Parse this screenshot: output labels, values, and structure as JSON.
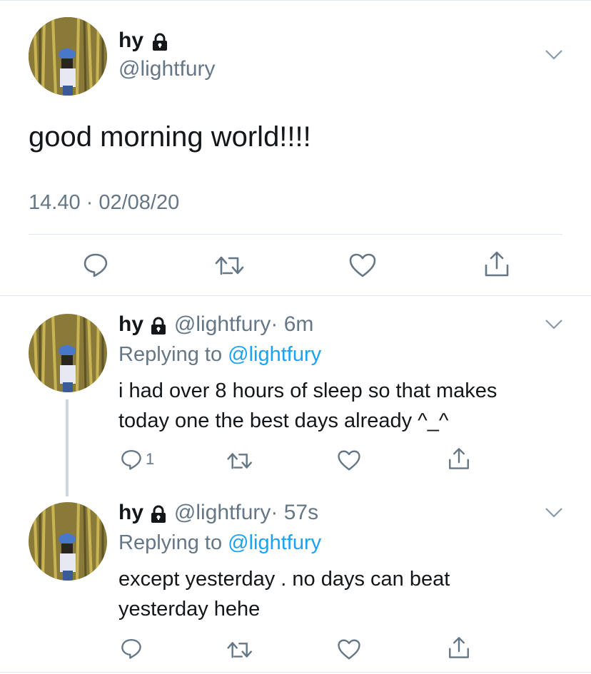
{
  "main_tweet": {
    "name": "hy",
    "handle": "@lightfury",
    "text": "good morning world!!!!",
    "timestamp": "14.40 · 02/08/20"
  },
  "replies": [
    {
      "name": "hy",
      "handle": "@lightfury",
      "time": "· 6m",
      "replying_prefix": "Replying to ",
      "replying_handle": "@lightfury",
      "text_line1": "i had over 8 hours of sleep so that makes",
      "text_line2": "today one the best days already ^_^",
      "reply_count": "1"
    },
    {
      "name": "hy",
      "handle": "@lightfury",
      "time": "· 57s",
      "replying_prefix": "Replying to ",
      "replying_handle": "@lightfury",
      "text_line1": "except yesterday . no days can beat",
      "text_line2": "yesterday hehe",
      "reply_count": ""
    }
  ],
  "colors": {
    "accent": "#1da1f2",
    "secondary_text": "#657786",
    "divider": "#e1e8ed",
    "thread_line": "#ccd6dd"
  }
}
